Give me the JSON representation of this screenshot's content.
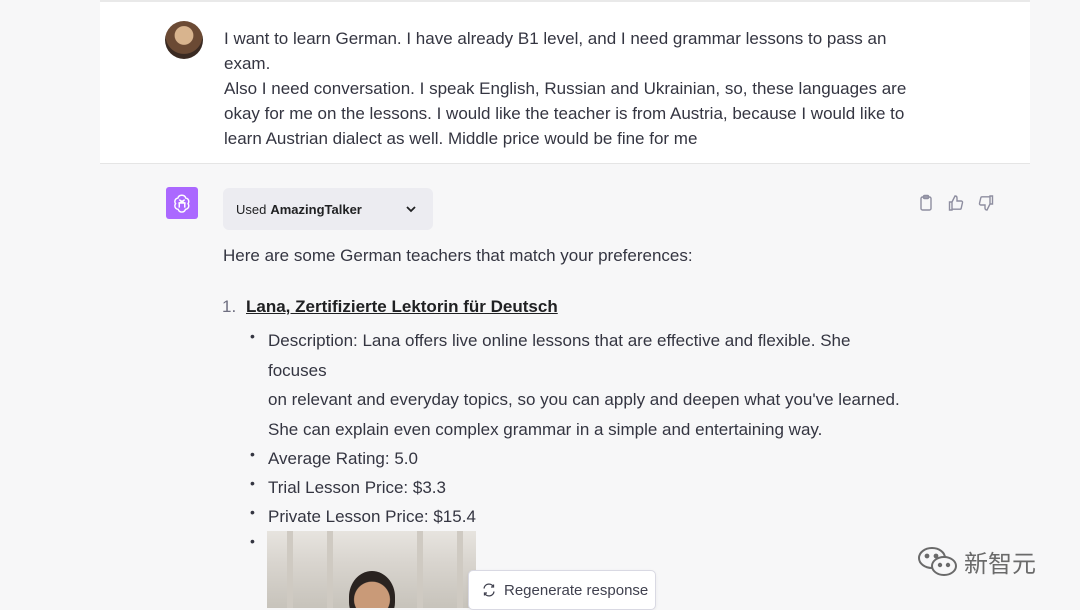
{
  "user_message": {
    "line1": "I want to learn German. I have already B1 level, and I need grammar lessons to pass an exam.",
    "line2": "Also I need conversation. I speak English, Russian and Ukrainian, so, these languages are",
    "line3": "okay for me on the lessons. I would like the teacher is from Austria, because I would like to",
    "line4": "learn Austrian dialect as well. Middle price would be fine for me"
  },
  "plugin": {
    "used_label": "Used",
    "name": "AmazingTalker"
  },
  "response": {
    "intro": "Here are some German teachers that match your preferences:",
    "teacher": {
      "number": "1.",
      "name": "Lana, Zertifizierte Lektorin für Deutsch",
      "description_l1": "Description: Lana offers live online lessons that are effective and flexible. She focuses",
      "description_l2": "on relevant and everyday topics, so you can apply and deepen what you've learned.",
      "description_l3": "She can explain even complex grammar in a simple and entertaining way.",
      "rating": "Average Rating: 5.0",
      "trial_price": "Trial Lesson Price: $3.3",
      "private_price": "Private Lesson Price: $15.4"
    }
  },
  "buttons": {
    "regenerate": "Regenerate response"
  },
  "watermark": {
    "text": "新智元"
  },
  "colors": {
    "plugin_logo": "#ab68ff",
    "background": "#f7f7f8",
    "user_bg": "#ffffff"
  },
  "icons": [
    "chatgpt-logo-icon",
    "chevron-down-icon",
    "clipboard-icon",
    "thumbs-up-icon",
    "thumbs-down-icon",
    "refresh-icon",
    "wechat-icon"
  ]
}
